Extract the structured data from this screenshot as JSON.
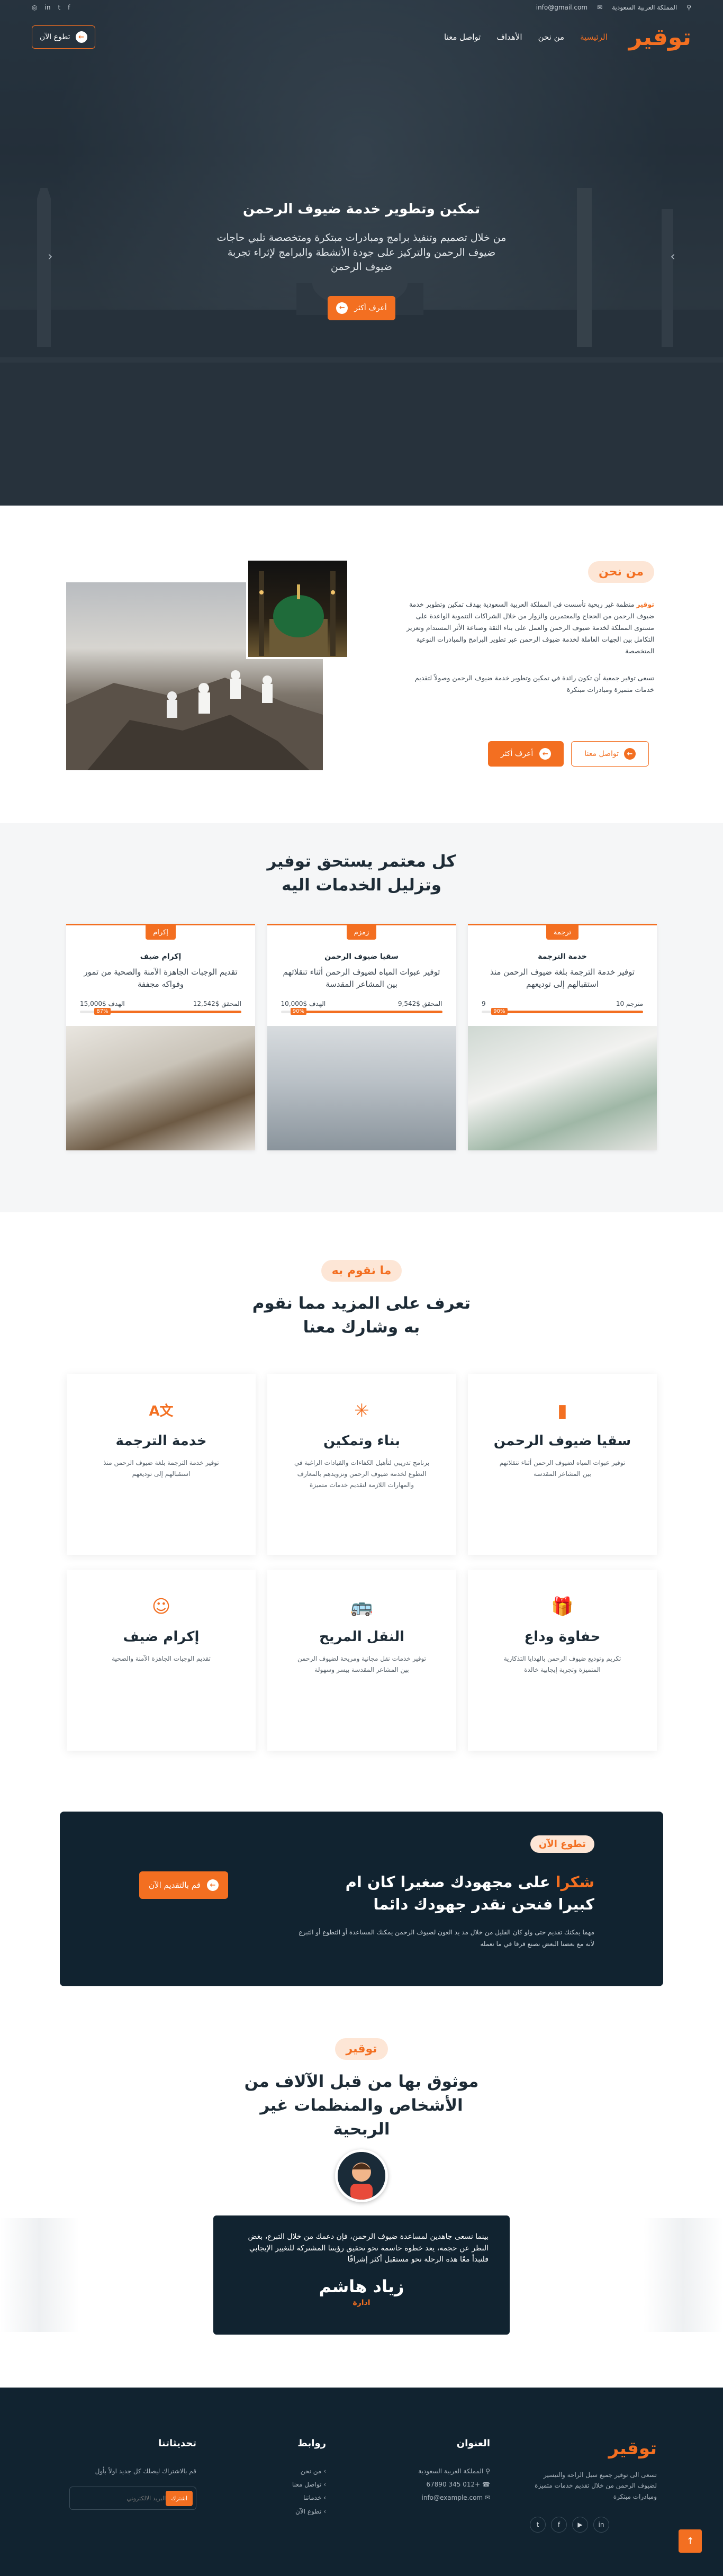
{
  "topbar": {
    "location": "المملكة العربية السعودية",
    "email": "info@gmail.com"
  },
  "nav": {
    "logo_main": "توقير",
    "items": [
      "الرئيسية",
      "من نحن",
      "الأهداف",
      "تواصل معنا"
    ],
    "volunteer_button": "تطوع الآن"
  },
  "hero": {
    "title": "تمكين وتطوير خدمة ضيوف الرحمن",
    "text": "من خلال تصميم وتنفيذ برامج ومبادرات مبتكرة ومتخصصة تلبي حاجات ضيوف الرحمن والتركيز على جودة الأنشطة والبرامج لإثراء تجربة ضيوف الرحمن",
    "button": "أعرف أكثر"
  },
  "about": {
    "badge": "من نحن",
    "brand": "توقير",
    "p1": "منظمة غير ربحية تأسست في المملكة العربية السعودية بهدف تمكين وتطوير خدمة ضيوف الرحمن من الحجاج والمعتمرين والزوار من خلال الشراكات التنموية الواعدة على مستوى المملكة لخدمة ضيوف الرحمن والعمل على بناء الثقة وصناعة الأثر المستدام وتعزيز التكامل بين الجهات العاملة لخدمة ضيوف الرحمن عبر تطوير البرامج والمبادرات النوعية المتخصصة",
    "p2": "تسعى توقير جمعية أن تكون رائدة في تمكين وتطوير خدمة ضيوف الرحمن وصولاً لتقديم خدمات متميزة ومبادرات مبتكرة",
    "more_button": "أعرف أكثر",
    "contact_button": "تواصل معنا"
  },
  "campaigns": {
    "title": "كل معتمر يستحق توفير وتزليل الخدمات اليه",
    "items": [
      {
        "tag": "إكرام",
        "name": "إكرام ضيف",
        "desc": "تقديم الوجبات الجاهزة الآمنة والصحية من تمور وفواكه مجففة",
        "raised": "$12,542",
        "raised_label": "المحقق",
        "goal": "$15,000",
        "goal_label": "الهدف",
        "pct": "87%",
        "pct_value": 87
      },
      {
        "tag": "زمزم",
        "name": "سقيا ضيوف الرحمن",
        "desc": "توفير عبوات المياه لضيوف الرحمن أثناء تنقلاتهم بين المشاعر المقدسة",
        "raised": "$9,542",
        "raised_label": "المحقق",
        "goal": "$10,000",
        "goal_label": "الهدف",
        "pct": "90%",
        "pct_value": 90
      },
      {
        "tag": "ترجمة",
        "name": "خدمة الترجمة",
        "desc": "توفير خدمة الترجمة بلغة ضيوف الرحمن منذ استقبالهم إلى توديعهم",
        "raised": "10",
        "raised_label": "مترجم",
        "goal": "9",
        "goal_label": "",
        "pct": "90%",
        "pct_value": 90
      }
    ]
  },
  "services": {
    "badge": "ما نقوم به",
    "title": "تعرف على المزيد مما نقوم به وشارك معنا",
    "items": [
      {
        "icon": "bottle-icon",
        "glyph": "▮",
        "title": "سقيا ضيوف الرحمن",
        "desc": "توفير عبوات المياه لضيوف الرحمن أثناء تنقلاتهم بين المشاعر المقدسة"
      },
      {
        "icon": "network-icon",
        "glyph": "✳",
        "title": "بناء وتمكين",
        "desc": "برنامج تدريبي لتأهيل الكفاءات والقيادات الراغبة في التطوع لخدمة ضيوف الرحمن وتزويدهم بالمعارف والمهارات اللازمة لتقديم خدمات متميزة"
      },
      {
        "icon": "translate-icon",
        "glyph": "A文",
        "title": "خدمة الترجمة",
        "desc": "توفير خدمة الترجمة بلغة ضيوف الرحمن منذ استقبالهم إلى توديعهم"
      },
      {
        "icon": "gift-icon",
        "glyph": "🎁",
        "title": "حفاوة وداع",
        "desc": "تكريم وتوديع ضيوف الرحمن بالهدايا التذكارية المتميزة وتجربة إيجابية خالدة"
      },
      {
        "icon": "bus-icon",
        "glyph": "🚌",
        "title": "النقل المريح",
        "desc": "توفير خدمات نقل مجانية ومريحة لضيوف الرحمن بين المشاعر المقدسة بيسر وسهولة"
      },
      {
        "icon": "smile-icon",
        "glyph": "☺",
        "title": "إكرام ضيف",
        "desc": "تقديم الوجبات الجاهزة الآمنة والصحية"
      }
    ]
  },
  "volunteer": {
    "badge": "تطوع الآن",
    "title_highlight": "شكرا",
    "title_rest": "على مجهودك صغيرا كان ام كبيرا فنحن نقدر جهودك دائما",
    "text": "مهما يمكنك تقديم حتى ولو كان القليل من خلال مد يد العون لضيوف الرحمن يمكنك المساعدة أو التطوع أو التبرع لأنه مع بعضنا البعض نصنع فرقا في ما نعمله",
    "button": "قم بالتقديم الآن"
  },
  "testimonials": {
    "badge": "توقير",
    "title": "موثوق بها من قبل الآلاف من الأشخاص والمنظمات غير الربحية",
    "quote": "بينما نسعى جاهدين لمساعدة ضيوف الرحمن، فإن دعمك من خلال التبرع، بغض النظر عن حجمه، يعد خطوة حاسمة نحو تحقيق رؤيتنا المشتركة للتغيير الإيجابي فلنبدأ معًا هذه الرحلة نحو مستقبل أكثر إشراقًا",
    "name": "زياد هاشم",
    "role": "ادارة"
  },
  "footer": {
    "logo": "توقير",
    "about": "تسعى الى توفير جميع سبل الراحة والتيسير لضيوف الرحمن من خلال تقديم خدمات متميزة ومبادرات مبتكرة",
    "address_title": "العنوان",
    "address": "المملكة العربية السعودية",
    "phone": "+012 345 67890",
    "email": "info@example.com",
    "links_title": "روابط",
    "links": [
      "من نحن",
      "تواصل معنا",
      "خدماتنا",
      "تطوع الآن"
    ],
    "updates_title": "تحديثاتنا",
    "updates_text": "قم بالاشتراك ليصلك كل جديد اولاً بأول",
    "subscribe_placeholder": "البريد الالكتروني",
    "subscribe_button": "اشترك"
  }
}
